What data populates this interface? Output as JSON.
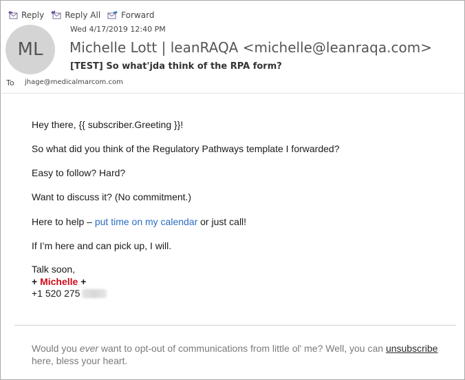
{
  "toolbar": {
    "reply_label": "Reply",
    "reply_all_label": "Reply All",
    "forward_label": "Forward"
  },
  "header": {
    "avatar_initials": "ML",
    "date": "Wed 4/17/2019 12:40 PM",
    "sender": "Michelle Lott | leanRAQA <michelle@leanraqa.com>",
    "subject": "[TEST] So what'jda think of the RPA form?",
    "to_label": "To",
    "to_value": "jhage@medicalmarcom.com"
  },
  "body": {
    "greeting": "Hey there, {{ subscriber.Greeting }}!",
    "line1": "So what did you think of the Regulatory Pathways template I forwarded?",
    "line2": "Easy to follow? Hard?",
    "line3": "Want to discuss it? (No commitment.)",
    "help_prefix": "Here to help – ",
    "help_link": "put time on my calendar",
    "help_suffix": " or just call!",
    "line5": "If I’m here and can pick up, I will.",
    "signoff": "Talk soon,",
    "sig_plus_left": "+ ",
    "sig_name": "Michelle",
    "sig_plus_right": " +",
    "phone": "+1 520 275"
  },
  "footer": {
    "text_a": "Would you ",
    "text_em": "ever",
    "text_b": " want to opt-out of communications from little ol' me? Well, you can ",
    "unsubscribe": "unsubscribe",
    "text_c": " here, bless your heart."
  },
  "colors": {
    "link": "#2a6cc0",
    "signature_red": "#d10a1a",
    "toolbar_icon": "#7a5aa0"
  }
}
